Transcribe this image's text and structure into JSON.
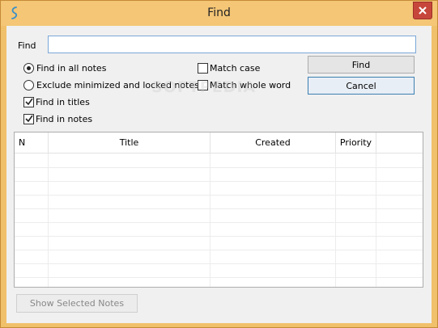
{
  "window": {
    "title": "Find",
    "app_icon": "notes-script-icon",
    "close_icon": "close-icon"
  },
  "find": {
    "label": "Find",
    "value": "",
    "placeholder": ""
  },
  "options": {
    "scope_all": "Find in all notes",
    "scope_all_selected": true,
    "scope_exclude": "Exclude minimized and locked notes",
    "scope_exclude_selected": false,
    "titles": "Find in titles",
    "titles_checked": true,
    "notes": "Find in notes",
    "notes_checked": true,
    "match_case": "Match case",
    "match_case_checked": false,
    "match_word": "Match whole word",
    "match_word_checked": false
  },
  "buttons": {
    "find": "Find",
    "cancel": "Cancel",
    "show_selected": "Show Selected Notes"
  },
  "grid": {
    "columns": [
      "N",
      "Title",
      "Created",
      "Priority"
    ],
    "rows": []
  },
  "watermark": "SOFTPEDIA",
  "colors": {
    "titlebar": "#f4c676",
    "close": "#c7463b",
    "focus_border": "#3c7fb1"
  }
}
